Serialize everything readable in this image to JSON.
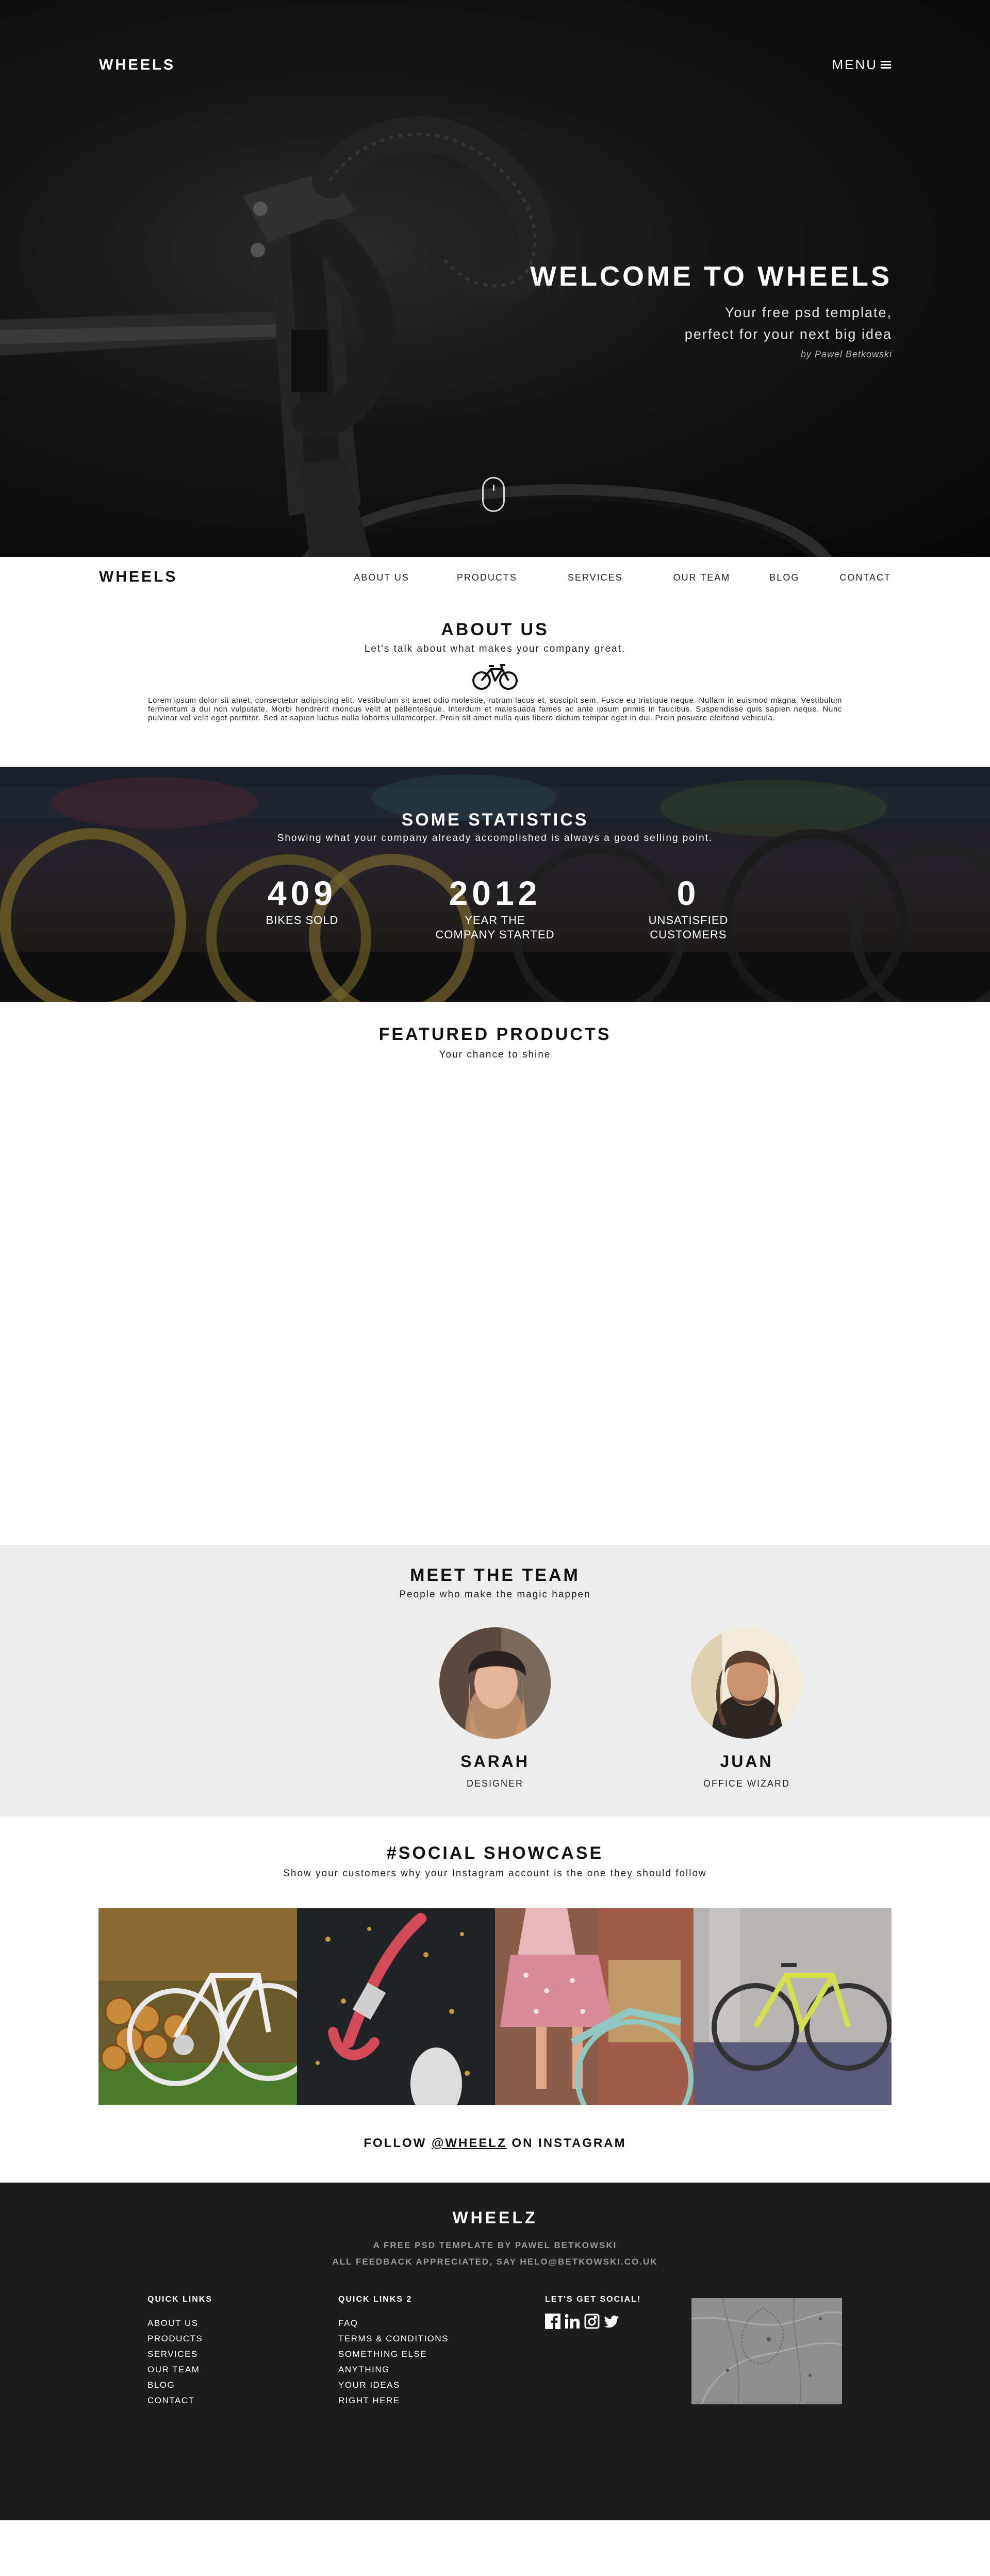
{
  "hero": {
    "logo": "WHEELS",
    "menu_label": "MENU",
    "title": "WELCOME TO WHEELS",
    "subtitle_line1": "Your free psd template,",
    "subtitle_line2": "perfect for your next big idea",
    "credit": "by Pawel Betkowski"
  },
  "navbar": {
    "logo": "WHEELS",
    "items": [
      "ABOUT US",
      "PRODUCTS",
      "SERVICES",
      "OUR TEAM",
      "BLOG",
      "CONTACT"
    ]
  },
  "about": {
    "title": "ABOUT US",
    "subtitle": "Let's talk about what makes your company great.",
    "icon": "bicycle-icon",
    "body": "Lorem ipsum dolor sit amet, consectetur adipiscing elit. Vestibulum sit amet odio molestie, rutrum lacus et, suscipit sem. Fusce eu tristique neque. Nullam in euismod magna. Vestibulum fermentum a dui non vulputate. Morbi hendrerit rhoncus velit at pellentesque. Interdum et malesuada fames ac ante ipsum primis in faucibus. Suspendisse quis sapien neque. Nunc pulvinar vel velit eget porttitor. Sed at sapien luctus nulla lobortis ullamcorper. Proin sit amet nulla quis libero dictum tempor eget in dui. Proin posuere eleifend vehicula."
  },
  "stats": {
    "title": "SOME STATISTICS",
    "subtitle": "Showing what your company already accomplished is always a good selling point.",
    "items": [
      {
        "value": "409",
        "label_line1": "BIKES SOLD",
        "label_line2": ""
      },
      {
        "value": "2012",
        "label_line1": "YEAR THE",
        "label_line2": "COMPANY STARTED"
      },
      {
        "value": "0",
        "label_line1": "UNSATISFIED",
        "label_line2": "CUSTOMERS"
      }
    ]
  },
  "featured": {
    "title": "FEATURED PRODUCTS",
    "subtitle": "Your chance to shine"
  },
  "team": {
    "title": "MEET THE TEAM",
    "subtitle": "People who make the magic happen",
    "members": [
      {
        "name": "SARAH",
        "role": "DESIGNER"
      },
      {
        "name": "JUAN",
        "role": "OFFICE WIZARD"
      }
    ]
  },
  "social": {
    "title": "#SOCIAL SHOWCASE",
    "subtitle": "Show your customers why your Instagram account is the one they should follow",
    "follow_prefix": "FOLLOW ",
    "follow_handle": "@WHEELZ",
    "follow_suffix": " ON INSTAGRAM"
  },
  "footer": {
    "title": "WHEELZ",
    "sub_line1": "A FREE PSD TEMPLATE BY PAWEL BETKOWSKI",
    "sub_line2": "ALL FEEDBACK APPRECIATED, SAY HELO@BETKOWSKI.CO.UK",
    "quick_links_title": "QUICK LINKS",
    "quick_links": [
      "ABOUT US",
      "PRODUCTS",
      "SERVICES",
      "OUR TEAM",
      "BLOG",
      "CONTACT"
    ],
    "quick_links2_title": "QUICK LINKS 2",
    "quick_links2": [
      "FAQ",
      "TERMS & CONDITIONS",
      "SOMETHING ELSE",
      "ANYTHING",
      "YOUR IDEAS",
      "RIGHT HERE"
    ],
    "social_title": "LET'S GET SOCIAL!",
    "social_icons": [
      "facebook-icon",
      "linkedin-icon",
      "instagram-icon",
      "twitter-icon"
    ]
  },
  "colors": {
    "hero_bg": "#0a0a0a",
    "team_bg": "#ededed",
    "footer_bg": "#1c1c1c",
    "text_dark": "#111111"
  }
}
